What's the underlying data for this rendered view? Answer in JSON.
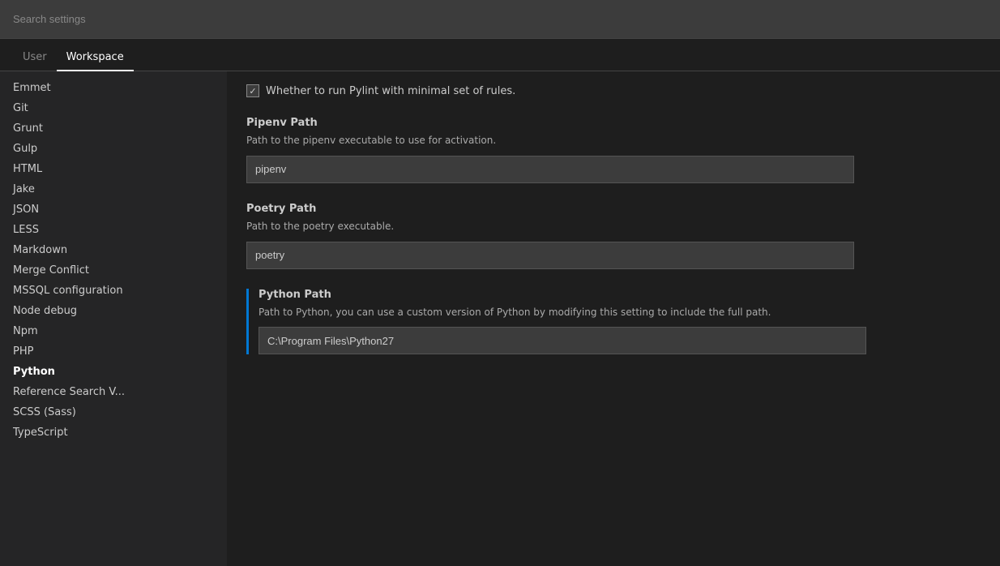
{
  "search": {
    "placeholder": "Search settings"
  },
  "tabs": [
    {
      "id": "user",
      "label": "User",
      "active": false
    },
    {
      "id": "workspace",
      "label": "Workspace",
      "active": true
    }
  ],
  "sidebar": {
    "items": [
      {
        "id": "emmet",
        "label": "Emmet",
        "active": false
      },
      {
        "id": "git",
        "label": "Git",
        "active": false
      },
      {
        "id": "grunt",
        "label": "Grunt",
        "active": false
      },
      {
        "id": "gulp",
        "label": "Gulp",
        "active": false
      },
      {
        "id": "html",
        "label": "HTML",
        "active": false
      },
      {
        "id": "jake",
        "label": "Jake",
        "active": false
      },
      {
        "id": "json",
        "label": "JSON",
        "active": false
      },
      {
        "id": "less",
        "label": "LESS",
        "active": false
      },
      {
        "id": "markdown",
        "label": "Markdown",
        "active": false
      },
      {
        "id": "merge-conflict",
        "label": "Merge Conflict",
        "active": false
      },
      {
        "id": "mssql",
        "label": "MSSQL configuration",
        "active": false
      },
      {
        "id": "node-debug",
        "label": "Node debug",
        "active": false
      },
      {
        "id": "npm",
        "label": "Npm",
        "active": false
      },
      {
        "id": "php",
        "label": "PHP",
        "active": false
      },
      {
        "id": "python",
        "label": "Python",
        "active": true
      },
      {
        "id": "reference-search",
        "label": "Reference Search V...",
        "active": false
      },
      {
        "id": "scss",
        "label": "SCSS (Sass)",
        "active": false
      },
      {
        "id": "typescript",
        "label": "TypeScript",
        "active": false
      }
    ]
  },
  "content": {
    "pylint_checkbox": {
      "checked": true,
      "label": "Whether to run Pylint with minimal set of rules."
    },
    "pipenv_path": {
      "title": "Pipenv Path",
      "description": "Path to the pipenv executable to use for activation.",
      "value": "pipenv"
    },
    "poetry_path": {
      "title": "Poetry Path",
      "description": "Path to the poetry executable.",
      "value": "poetry"
    },
    "python_path": {
      "title": "Python Path",
      "description": "Path to Python, you can use a custom version of Python by modifying this setting to include the full path.",
      "value": "C:\\Program Files\\Python27",
      "highlighted": true
    }
  },
  "colors": {
    "accent": "#0078d4",
    "bg_primary": "#1e1e1e",
    "bg_sidebar": "#252526",
    "bg_input": "#3c3c3c",
    "text_primary": "#cccccc",
    "text_secondary": "#aaaaaa"
  }
}
